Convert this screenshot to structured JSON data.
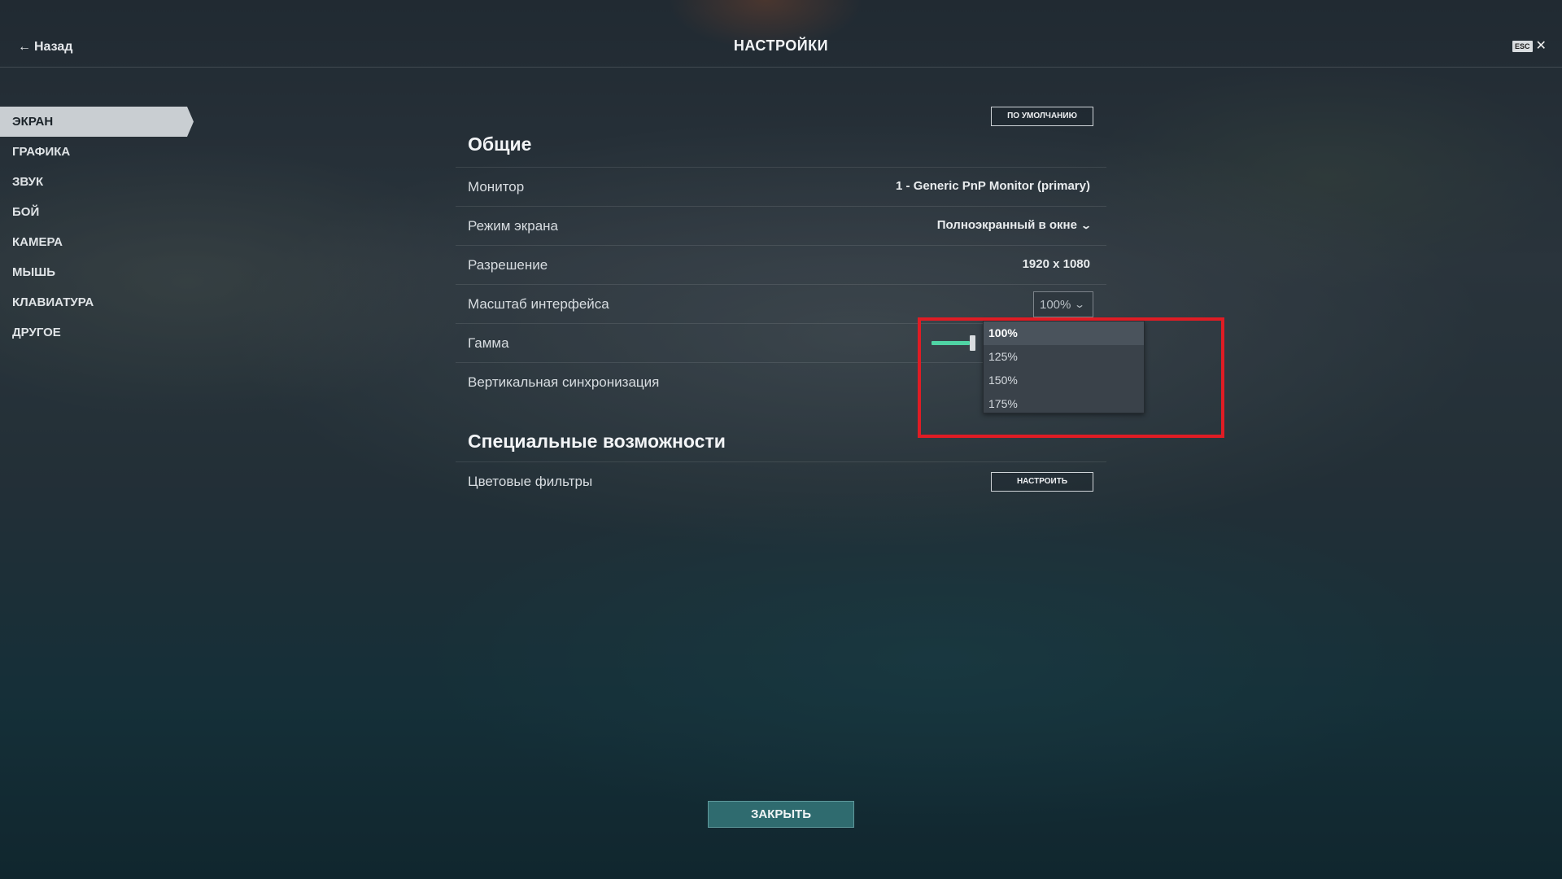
{
  "header": {
    "back_label": "Назад",
    "title": "НАСТРОЙКИ",
    "esc_label": "ESC",
    "close_symbol": "✕"
  },
  "sidebar": {
    "items": [
      {
        "label": "ЭКРАН",
        "active": true
      },
      {
        "label": "ГРАФИКА",
        "active": false
      },
      {
        "label": "ЗВУК",
        "active": false
      },
      {
        "label": "БОЙ",
        "active": false
      },
      {
        "label": "КАМЕРА",
        "active": false
      },
      {
        "label": "МЫШЬ",
        "active": false
      },
      {
        "label": "КЛАВИАТУРА",
        "active": false
      },
      {
        "label": "ДРУГОЕ",
        "active": false
      }
    ]
  },
  "main": {
    "default_button": "ПО УМОЛЧАНИЮ",
    "general_section": {
      "title": "Общие",
      "monitor": {
        "label": "Монитор",
        "value": "1 - Generic PnP Monitor (primary)"
      },
      "screen_mode": {
        "label": "Режим экрана",
        "value": "Полноэкранный в окне"
      },
      "resolution": {
        "label": "Разрешение",
        "value": "1920 x 1080"
      },
      "ui_scale": {
        "label": "Масштаб интерфейса",
        "value": "100%"
      },
      "gamma": {
        "label": "Гамма",
        "level": 0.78
      },
      "vsync": {
        "label": "Вертикальная синхронизация"
      }
    },
    "accessibility_section": {
      "title": "Специальные возможности",
      "color_filters": {
        "label": "Цветовые фильтры",
        "button": "НАСТРОИТЬ"
      }
    }
  },
  "scale_dropdown": {
    "options": [
      "100%",
      "125%",
      "150%",
      "175%"
    ],
    "selected": "100%"
  },
  "footer": {
    "close_button": "ЗАКРЫТЬ"
  },
  "colors": {
    "accent_green": "#4fd3a4",
    "close_button_bg": "#2f6b6f",
    "highlight_red": "#e01c24"
  }
}
